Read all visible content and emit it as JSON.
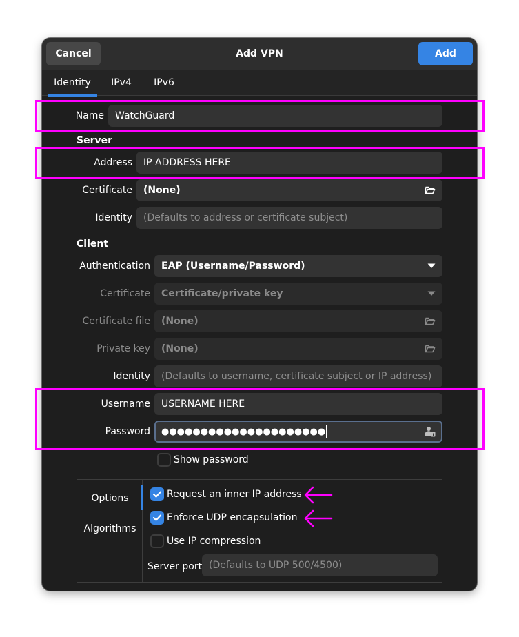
{
  "header": {
    "title": "Add VPN",
    "cancel_label": "Cancel",
    "add_label": "Add",
    "accent_color": "#3584e4"
  },
  "tabs": [
    {
      "label": "Identity",
      "active": true
    },
    {
      "label": "IPv4",
      "active": false
    },
    {
      "label": "IPv6",
      "active": false
    }
  ],
  "identity": {
    "name_label": "Name",
    "name_value": "WatchGuard",
    "server_section": "Server",
    "address_label": "Address",
    "address_value": "IP ADDRESS HERE",
    "server_certificate_label": "Certificate",
    "server_certificate_value": "(None)",
    "server_identity_label": "Identity",
    "server_identity_placeholder": "(Defaults to address or certificate subject)",
    "client_section": "Client",
    "authentication_label": "Authentication",
    "authentication_value": "EAP (Username/Password)",
    "client_certificate_label": "Certificate",
    "client_certificate_value": "Certificate/private key",
    "certificate_file_label": "Certificate file",
    "certificate_file_value": "(None)",
    "private_key_label": "Private key",
    "private_key_value": "(None)",
    "client_identity_label": "Identity",
    "client_identity_placeholder": "(Defaults to username, certificate subject or IP address)",
    "username_label": "Username",
    "username_value": "USERNAME HERE",
    "password_label": "Password",
    "password_masked": "●●●●●●●●●●●●●●●●●●●●●",
    "show_password_label": "Show password",
    "show_password_checked": false
  },
  "options_panel": {
    "sidebar": [
      {
        "label": "Options",
        "active": true
      },
      {
        "label": "Algorithms",
        "active": false
      }
    ],
    "request_inner_ip_label": "Request an inner IP address",
    "request_inner_ip_checked": true,
    "enforce_udp_label": "Enforce UDP encapsulation",
    "enforce_udp_checked": true,
    "ip_compression_label": "Use IP compression",
    "ip_compression_checked": false,
    "server_port_label": "Server port",
    "server_port_placeholder": "(Defaults to UDP 500/4500)"
  },
  "annotations": {
    "highlight_color": "#ff00ff"
  }
}
